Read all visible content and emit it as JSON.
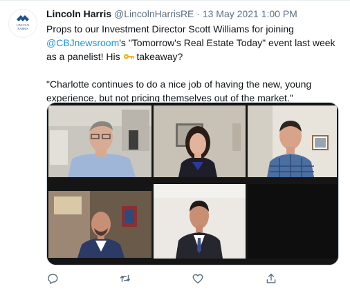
{
  "tweet": {
    "author_name": "Lincoln Harris",
    "handle": "@LincolnHarrisRE",
    "separator": " · ",
    "date": "13 May 2021 1:00 PM",
    "logo_text_line1": "LINCOLN",
    "logo_text_line2": "HARRIS",
    "text_part1": "Props to our Investment Director Scott Williams for joining ",
    "mention": "@CBJnewsroom",
    "text_part2": "'s \"Tomorrow's Real Estate Today\" event last week as a panelist! His ",
    "emoji": "key",
    "text_part3": " takeaway?",
    "quote": "\"Charlotte continues to do a nice job of having the new, young experience, but not pricing themselves out of the market.\"",
    "media_description_icon": "video-call-screenshot"
  },
  "actions": {
    "reply_icon": "reply-icon",
    "retweet_icon": "retweet-icon",
    "like_icon": "heart-icon",
    "share_icon": "share-icon"
  },
  "colors": {
    "link": "#1b95e0",
    "text": "#0f1419",
    "muted": "#5b7083",
    "brand": "#1f4e8c"
  }
}
